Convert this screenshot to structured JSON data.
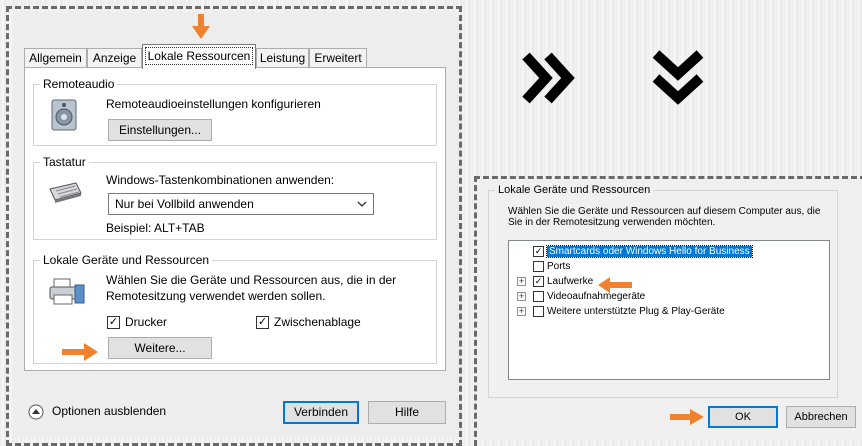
{
  "colors": {
    "accent_orange": "#f0812e",
    "primary_border": "#0078d7",
    "dash": "#6a6a6a"
  },
  "tabs": [
    {
      "label": "Allgemein"
    },
    {
      "label": "Anzeige"
    },
    {
      "label": "Lokale Ressourcen"
    },
    {
      "label": "Leistung"
    },
    {
      "label": "Erweitert"
    }
  ],
  "remoteaudio": {
    "legend": "Remoteaudio",
    "description": "Remoteaudioeinstellungen konfigurieren",
    "settings_button": "Einstellungen..."
  },
  "tastatur": {
    "legend": "Tastatur",
    "label": "Windows-Tastenkombinationen anwenden:",
    "combo_value": "Nur bei Vollbild anwenden",
    "example": "Beispiel: ALT+TAB"
  },
  "local_devices": {
    "legend": "Lokale Geräte und Ressourcen",
    "description_line1": "Wählen Sie die Geräte und Ressourcen aus, die in der",
    "description_line2": "Remotesitzung verwendet werden sollen.",
    "printer_label": "Drucker",
    "clipboard_label": "Zwischenablage",
    "more_button": "Weitere..."
  },
  "footer": {
    "options_label": "Optionen ausblenden",
    "connect_button": "Verbinden",
    "help_button": "Hilfe"
  },
  "arrows": {
    "right": "»",
    "down": "»"
  },
  "detail": {
    "legend": "Lokale Geräte und Ressourcen",
    "description_line1": "Wählen Sie die Geräte und Ressourcen auf diesem Computer aus, die",
    "description_line2": "Sie in der Remotesitzung verwenden möchten.",
    "tree": [
      {
        "label": "Smartcards oder Windows Hello for Business",
        "checked": true,
        "expandable": false,
        "selected": true
      },
      {
        "label": "Ports",
        "checked": false,
        "expandable": false,
        "selected": false
      },
      {
        "label": "Laufwerke",
        "checked": true,
        "expandable": true,
        "selected": false
      },
      {
        "label": "Videoaufnahmegeräte",
        "checked": false,
        "expandable": true,
        "selected": false
      },
      {
        "label": "Weitere unterstützte Plug & Play-Geräte",
        "checked": false,
        "expandable": true,
        "selected": false
      }
    ],
    "ok_button": "OK",
    "cancel_button": "Abbrechen"
  }
}
